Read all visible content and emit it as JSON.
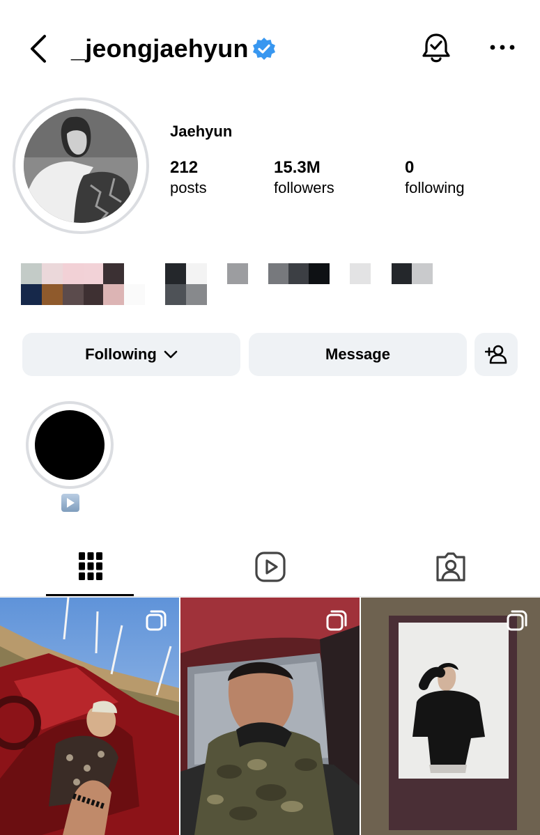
{
  "header": {
    "username": "_jeongjaehyun",
    "icons": {
      "back": "chevron-left-icon",
      "verified": "verified-badge-icon",
      "notifications": "bell-check-icon",
      "more": "more-horizontal-icon"
    },
    "accent_color": "#3897f0"
  },
  "profile": {
    "display_name": "Jaehyun",
    "stats": [
      {
        "value": "212",
        "label": "posts"
      },
      {
        "value": "15.3M",
        "label": "followers"
      },
      {
        "value": "0",
        "label": "following"
      }
    ]
  },
  "actions": {
    "following_label": "Following",
    "message_label": "Message",
    "icons": {
      "following_dropdown": "chevron-down-icon",
      "suggest": "add-person-icon"
    }
  },
  "highlights": [
    {
      "label_icon": "play-button-icon"
    }
  ],
  "tabs": [
    {
      "icon": "grid-icon",
      "active": true
    },
    {
      "icon": "reels-icon",
      "active": false
    },
    {
      "icon": "tagged-icon",
      "active": false
    }
  ],
  "posts": [
    {
      "scene": "red convertible car in desert with wind turbines",
      "multiple": true
    },
    {
      "scene": "selfie in car with camouflage jacket",
      "multiple": true
    },
    {
      "scene": "polaroid photo on brown surface",
      "multiple": true
    }
  ]
}
